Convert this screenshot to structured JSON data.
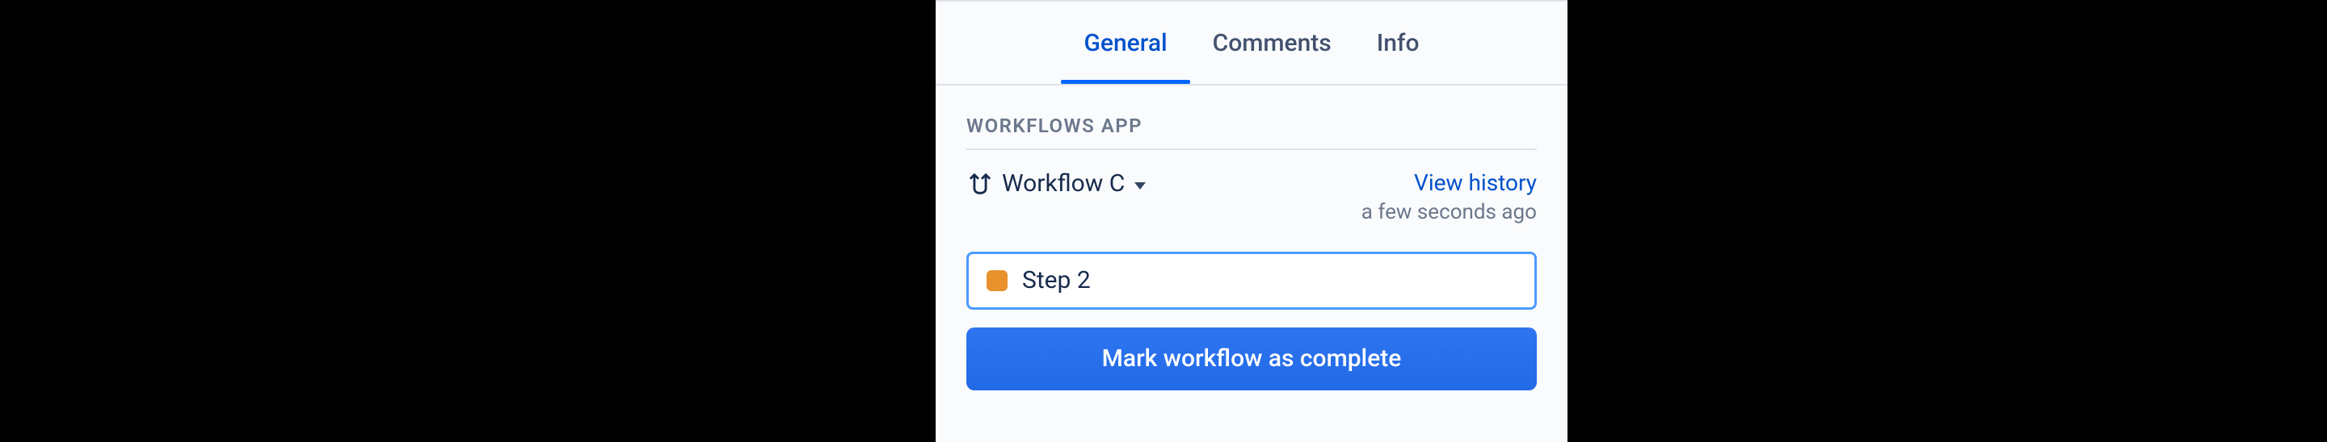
{
  "tabs": {
    "general": "General",
    "comments": "Comments",
    "info": "Info"
  },
  "section": {
    "title": "WORKFLOWS APP"
  },
  "workflow": {
    "name": "Workflow C",
    "view_history": "View history",
    "time_ago": "a few seconds ago"
  },
  "step": {
    "label": "Step 2",
    "status_color": "#E8912D"
  },
  "actions": {
    "complete": "Mark workflow as complete"
  }
}
